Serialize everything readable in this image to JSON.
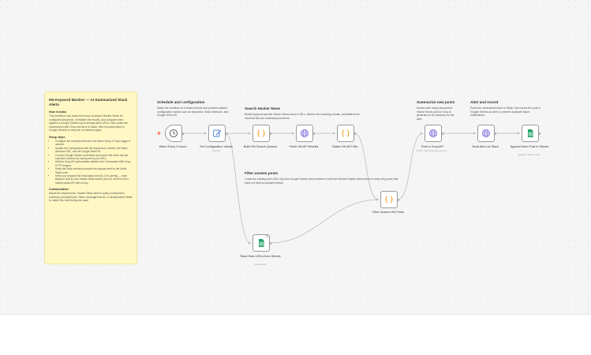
{
  "notes": {
    "main": {
      "title": "HN Keyword Monitor — AI-Summarized Slack Alerts",
      "how_heading": "How it works",
      "how_text": "This workflow runs every few hours to search Hacker News for configured keywords, normalize the results, and compare them against a Google Sheets log of already-seen URLs. New posts are summarized with Groq and sent to Slack, then recorded back to Google Sheets so they are not alerted again.",
      "setup_heading": "Setup steps",
      "setup_steps": [
        "Configure the schedule interval in the When Every 2 Hours trigger if needed.",
        "Update the Configuration with the keywords to monitor, the Slack webhook URL, and the Google Sheet ID.",
        "Connect Google Sheets credentials and ensure the sheet has the expected columns for storing seen post URLs.",
        "Add the Groq API authorization details to the Summarize With Groq HTTP request.",
        "Verify the Slack webhook accepts the payload sent by the Notify Slack node.",
        "Keep your keyword list reasonably short (5–10 is plenty) — each keyword runs its own Hacker News search per poll, and this hits a shared public API with no key."
      ],
      "custom_heading": "Customization",
      "custom_text": "Adjust the keyword list, Hacker News search query construction, summary prompt/model, Slack message format, or deduplication fields to match the monitoring use case."
    },
    "schedule": {
      "title": "Schedule and configuration",
      "text": "Starts the workflow on a timed interval and provides shared configuration values such as keywords, Slack webhook, and Google Sheet ID."
    },
    "search": {
      "title": "Search Hacker News",
      "text": "Builds keyword-specific Hacker News search URLs, fetches the matching results, and flattens the returned hits into individual post items."
    },
    "filter": {
      "title": "Filter unseen posts",
      "text": "Loads the existing seen-URL log from Google Sheets and combines it with the fetched Hacker News items to keep only posts that have not been processed before."
    },
    "summarize": {
      "title": "Summarize new posts",
      "text": "Sends each newly discovered Hacker News post to Groq to generate an AI summary for the alert."
    },
    "alert": {
      "title": "Alert and record",
      "text": "Posts the summarized alert to Slack, then saves the post to Google Sheets as seen to prevent duplicate future notifications."
    }
  },
  "nodes": [
    {
      "id": "trigger",
      "label": "When Every 2 Hours",
      "sub": "",
      "icon": "clock-icon",
      "color": "#555555"
    },
    {
      "id": "config",
      "label": "Set Configuration Values",
      "sub": "manual",
      "icon": "edit-icon",
      "color": "#4a7fd4"
    },
    {
      "id": "build",
      "label": "Build HN Search Queries",
      "sub": "",
      "icon": "code-icon",
      "color": "#f0a020"
    },
    {
      "id": "fetch",
      "label": "Fetch HN API Results",
      "sub": "",
      "icon": "globe-icon",
      "color": "#7a6ad8"
    },
    {
      "id": "flatten",
      "label": "Flatten HN API Hits",
      "sub": "",
      "icon": "code-icon",
      "color": "#f0a020"
    },
    {
      "id": "read",
      "label": "Read Seen URLs from Sheets",
      "sub": "read: sheet",
      "icon": "sheets-icon",
      "color": "#21a366"
    },
    {
      "id": "filter",
      "label": "Filter Unseen HN Posts",
      "sub": "",
      "icon": "code-icon",
      "color": "#f0a020"
    },
    {
      "id": "groq",
      "label": "Post to Groq API",
      "sub": "POST: https://api.groq.com/o...",
      "icon": "globe-icon",
      "color": "#7a6ad8"
    },
    {
      "id": "slack",
      "label": "Send Alert via Slack",
      "sub": "",
      "icon": "globe-icon",
      "color": "#7a6ad8"
    },
    {
      "id": "append",
      "label": "Append Seen Post in Sheets",
      "sub": "append: sheet: sheet",
      "icon": "sheets-icon",
      "color": "#21a366"
    }
  ]
}
